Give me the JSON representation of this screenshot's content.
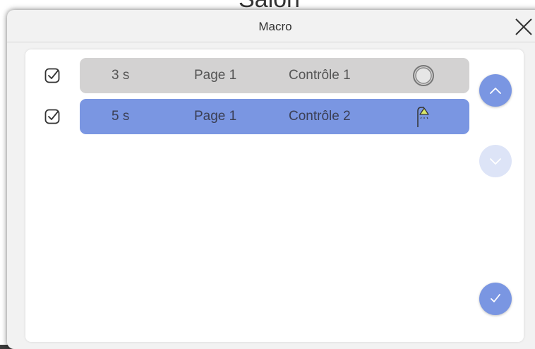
{
  "background": {
    "partial_title_text": "Salon"
  },
  "dialog": {
    "title": "Macro",
    "close_icon": "close-icon",
    "colors": {
      "accent": "#7a96e2",
      "accent_disabled": "#dde4f7",
      "row_inactive": "#d3d2d2"
    }
  },
  "macro": {
    "rows": [
      {
        "checked": true,
        "delay": "3 s",
        "page": "Page 1",
        "control": "Contrôle 1",
        "icon": "ring-icon",
        "selected": false
      },
      {
        "checked": true,
        "delay": "5 s",
        "page": "Page 1",
        "control": "Contrôle 2",
        "icon": "lamp-icon",
        "selected": true
      }
    ]
  },
  "controls": {
    "move_up_icon": "chevron-up-icon",
    "move_down_icon": "chevron-down-icon",
    "move_down_enabled": false,
    "confirm_icon": "checkmark-icon"
  }
}
